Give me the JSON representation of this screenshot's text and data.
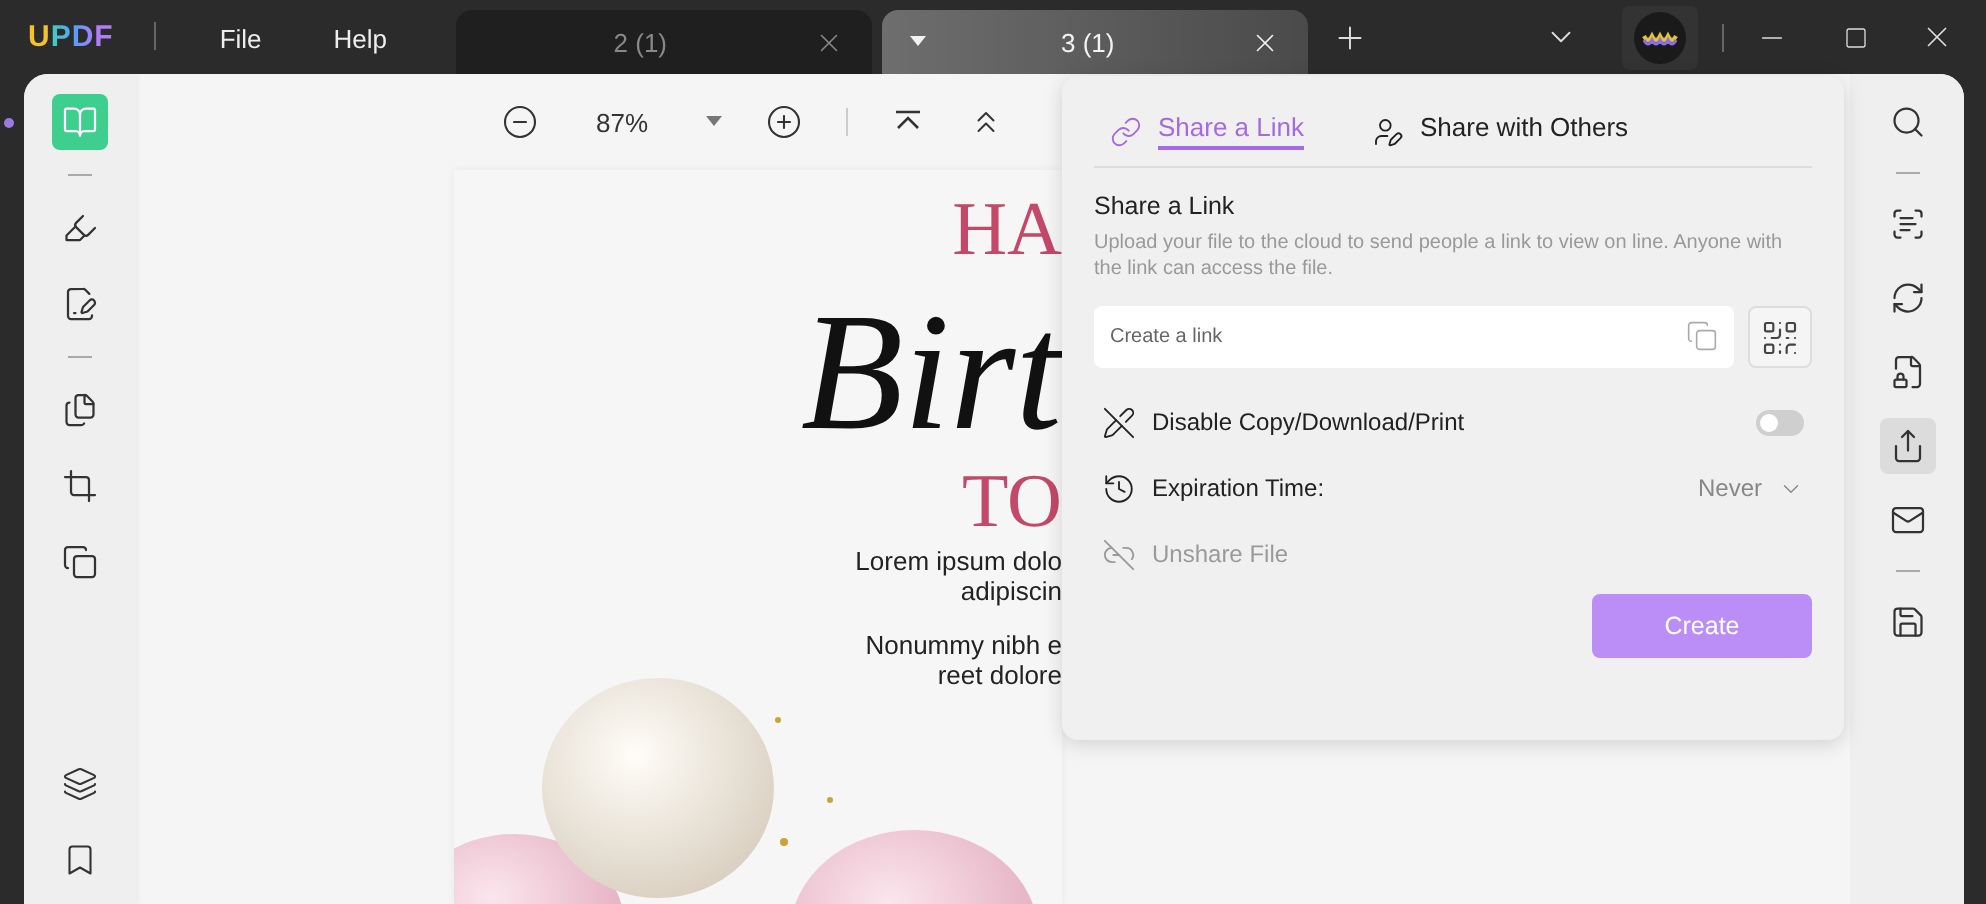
{
  "app": {
    "logo": "UPDF",
    "menu": [
      "File",
      "Help"
    ]
  },
  "tabs": [
    {
      "label": "2 (1)",
      "selected": false
    },
    {
      "label": "3 (1)",
      "selected": true
    }
  ],
  "toolbar": {
    "zoom": "87%"
  },
  "left_tool_groups": [
    {
      "tools": [
        {
          "selected": true
        }
      ]
    },
    {
      "tools": [
        {
          "selected": false
        },
        {
          "selected": false
        }
      ]
    },
    {
      "tools": [
        {
          "selected": false
        },
        {
          "selected": false
        },
        {
          "selected": false
        }
      ]
    }
  ],
  "left_bottom_tools": [
    {
      "selected": false
    },
    {
      "selected": false
    }
  ],
  "document": {
    "lines": [
      {
        "kind": "title",
        "text": "HA"
      },
      {
        "kind": "script",
        "text": "Birt"
      },
      {
        "kind": "title",
        "text": "TO"
      },
      {
        "kind": "body",
        "text": "Lorem ipsum dolo"
      },
      {
        "kind": "body",
        "text": "adipiscin"
      },
      {
        "kind": "gap",
        "text": "Nonummy nibh e"
      },
      {
        "kind": "body",
        "text": "reet dolore"
      }
    ]
  },
  "right_tool_groups": [
    {
      "tools": [
        {
          "selected": false
        }
      ]
    },
    {
      "tools": [
        {
          "selected": false
        },
        {
          "selected": false
        },
        {
          "selected": false
        },
        {
          "selected": true
        },
        {
          "selected": false
        }
      ]
    },
    {
      "tools": [
        {
          "selected": false
        }
      ]
    }
  ],
  "share_panel": {
    "tabs": [
      {
        "label": "Share a Link",
        "selected": true
      },
      {
        "label": "Share with Others",
        "selected": false
      }
    ],
    "heading": "Share a Link",
    "description": "Upload your file to the cloud to send people a link to view on line. Anyone with the link can access the file.",
    "link_field": {
      "placeholder": "Create a link"
    },
    "options": [
      {
        "kind": "toggle",
        "label": "Disable Copy/Download/Print",
        "on": false,
        "disabled": false
      },
      {
        "kind": "select",
        "label": "Expiration Time:",
        "value": "Never",
        "disabled": false
      },
      {
        "kind": "action",
        "label": "Unshare File",
        "disabled": true
      }
    ],
    "create_button": "Create"
  }
}
